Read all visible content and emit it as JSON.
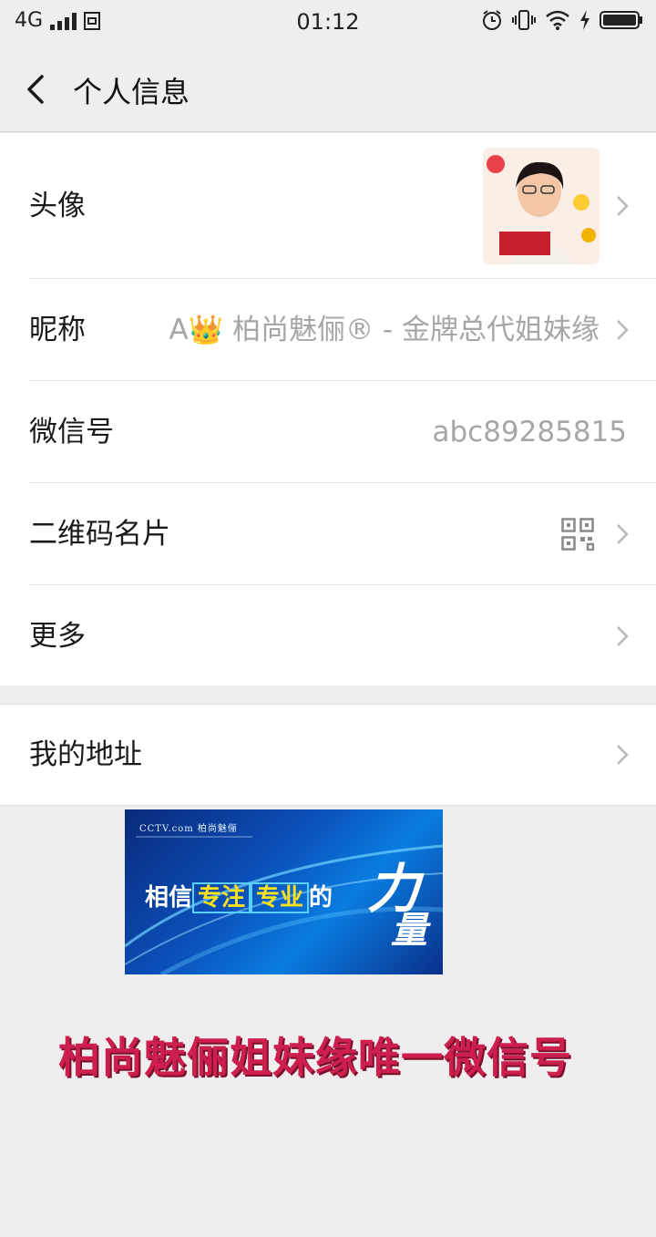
{
  "status_bar": {
    "network": "4G",
    "time": "01:12"
  },
  "nav": {
    "title": "个人信息"
  },
  "profile": {
    "avatar_label": "头像",
    "nickname_label": "昵称",
    "nickname_value": "A👑 柏尚魅俪® - 金牌总代姐妹缘",
    "wechat_id_label": "微信号",
    "wechat_id_value": "abc89285815",
    "qr_label": "二维码名片",
    "more_label": "更多"
  },
  "address": {
    "label": "我的地址"
  },
  "banner": {
    "top_text": "CCTV.com 柏尚魅俪",
    "line_prefix": "相信",
    "highlight_1": "专注",
    "highlight_2": "专业",
    "line_suffix": "的",
    "big_1": "力",
    "big_2": "量"
  },
  "slogan": "柏尚魅俪姐妹缘唯一微信号",
  "colors": {
    "background": "#efedee",
    "slogan": "#cc1f4e",
    "value_text": "#a6a6a6"
  },
  "icons": [
    "back-arrow-icon",
    "chevron-right-icon",
    "qr-code-icon",
    "signal-icon",
    "alarm-icon",
    "vibrate-icon",
    "wifi-icon",
    "battery-icon"
  ]
}
